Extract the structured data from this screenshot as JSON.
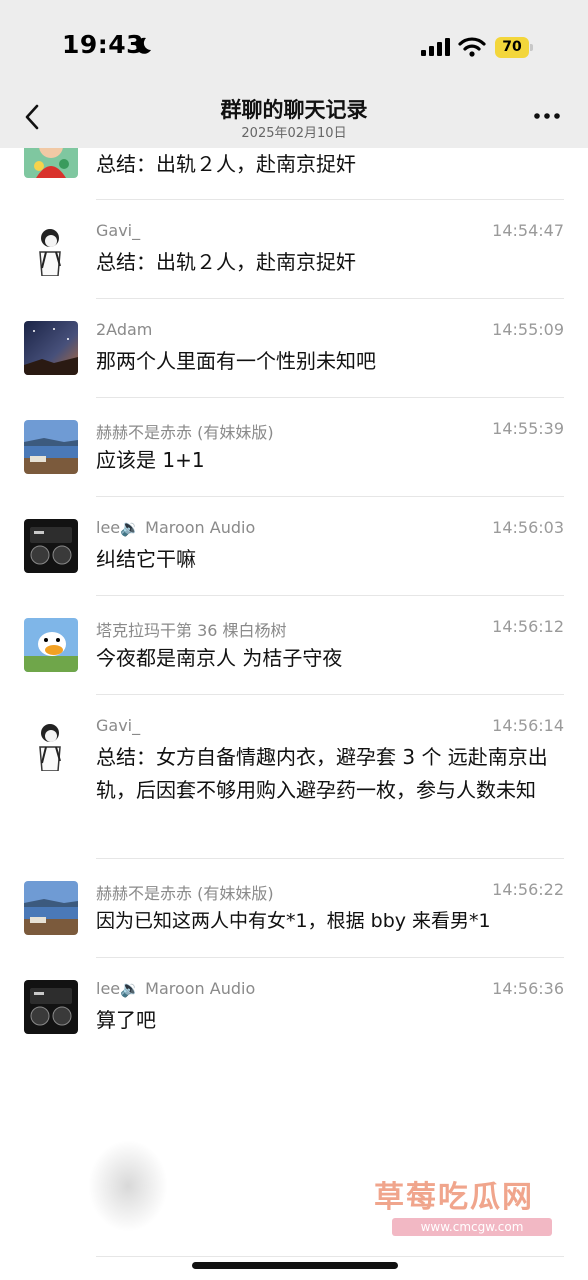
{
  "status": {
    "time": "19:43",
    "battery": "70"
  },
  "nav": {
    "title": "群聊的聊天记录",
    "date": "2025年02月10日"
  },
  "messages": [
    {
      "sender": "",
      "time": "",
      "text": "总结：出轨２人，赴南京捉奸",
      "avatar": "cartoon-avatar"
    },
    {
      "sender": "Gavi_",
      "time": "14:54:47",
      "text": "总结：出轨２人，赴南京捉奸",
      "avatar": "sketch-avatar"
    },
    {
      "sender": "2Adam",
      "time": "14:55:09",
      "text": "那两个人里面有一个性别未知吧",
      "avatar": "night-sky-avatar"
    },
    {
      "sender": "赫赫不是赤赤 (有妹妹版)",
      "time": "14:55:39",
      "text": "应该是 1+1",
      "avatar": "lake-avatar"
    },
    {
      "sender": "lee🔉 Maroon Audio",
      "time": "14:56:03",
      "text": "纠结它干嘛",
      "avatar": "audio-avatar"
    },
    {
      "sender": "塔克拉玛干第 36 棵白杨树",
      "time": "14:56:12",
      "text": "今夜都是南京人 为桔子守夜",
      "avatar": "duck-avatar"
    },
    {
      "sender": "Gavi_",
      "time": "14:56:14",
      "text": "总结：女方自备情趣内衣，避孕套 3 个 远赴南京出轨，后因套不够用购入避孕药一枚，参与人数未知",
      "avatar": "sketch-avatar"
    },
    {
      "sender": "赫赫不是赤赤 (有妹妹版)",
      "time": "14:56:22",
      "text": "因为已知这两人中有女*1，根据 bby 来看男*1",
      "avatar": "lake-avatar"
    },
    {
      "sender": "lee🔉 Maroon Audio",
      "time": "14:56:36",
      "text": "算了吧",
      "avatar": "audio-avatar"
    }
  ],
  "watermark": {
    "name": "草莓吃瓜网",
    "url": "www.cmcgw.com"
  }
}
